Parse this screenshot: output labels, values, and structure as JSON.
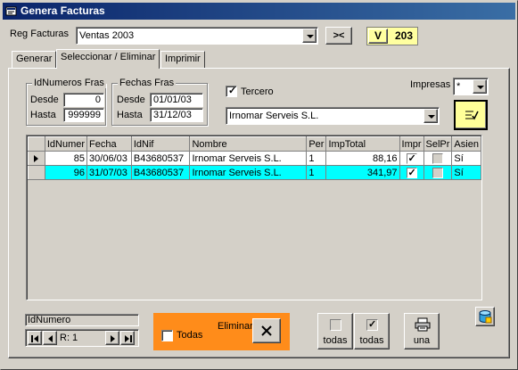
{
  "window": {
    "title": "Genera Facturas"
  },
  "reg_facturas": {
    "label": "Reg Facturas",
    "value": "Ventas 2003"
  },
  "buttons": {
    "collapse": "><",
    "v": "V",
    "counter": "203"
  },
  "tabs": [
    {
      "label": "Generar"
    },
    {
      "label": "Seleccionar / Eliminar"
    },
    {
      "label": "Imprimir"
    }
  ],
  "idnumeros": {
    "title": "IdNumeros Fras",
    "desde_label": "Desde",
    "desde": "0",
    "hasta_label": "Hasta",
    "hasta": "999999"
  },
  "fechas": {
    "title": "Fechas Fras",
    "desde_label": "Desde",
    "desde": "01/01/03",
    "hasta_label": "Hasta",
    "hasta": "31/12/03"
  },
  "tercero": {
    "label": "Tercero",
    "checked": true,
    "value": "Irnomar Serveis S.L."
  },
  "impresas": {
    "label": "Impresas",
    "value": "*"
  },
  "grid": {
    "headers": [
      "IdNumer",
      "Fecha",
      "IdNif",
      "Nombre",
      "Per",
      "ImpTotal",
      "Impr",
      "SelPr",
      "Asien"
    ],
    "rows": [
      {
        "id": "85",
        "fecha": "30/06/03",
        "nif": "B43680537",
        "nombre": "Irnomar Serveis S.L.",
        "per": "1",
        "total": "88,16",
        "impr": true,
        "selpr": false,
        "asien": "Sí"
      },
      {
        "id": "96",
        "fecha": "31/07/03",
        "nif": "B43680537",
        "nombre": "Irnomar Serveis S.L.",
        "per": "1",
        "total": "341,97",
        "impr": true,
        "selpr": false,
        "asien": "Sí"
      }
    ],
    "selected_color": "#00ffff"
  },
  "navigator": {
    "label": "IdNumero",
    "record": "R: 1"
  },
  "eliminar": {
    "title": "Eliminar",
    "todas_label": "Todas",
    "color": "#ff8c1a"
  },
  "actions": {
    "desmarcar_label": "todas",
    "marcar_label": "todas",
    "imprimir_label": "una"
  }
}
